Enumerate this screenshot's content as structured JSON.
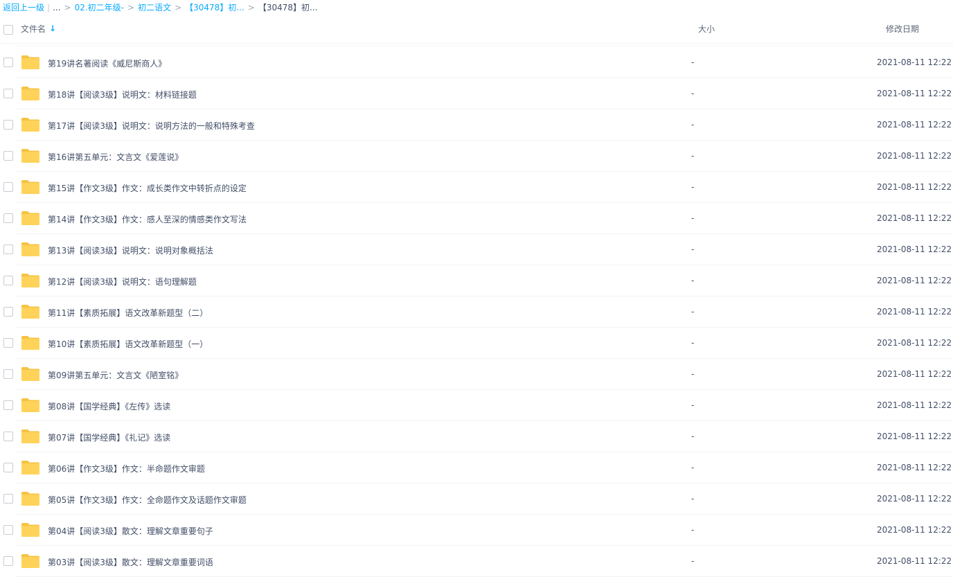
{
  "breadcrumb": {
    "back_label": "返回上一级",
    "separator": "|",
    "ellipsis": "...",
    "crumbs": [
      "02.初二年级-",
      "初二语文",
      "【30478】初..."
    ],
    "current": "【30478】初...",
    "arrow": ">"
  },
  "header": {
    "name_label": "文件名",
    "sort_arrow": "↓",
    "size_label": "大小",
    "date_label": "修改日期"
  },
  "colors": {
    "link": "#09aaff",
    "folder": "#ffd25a",
    "folder_tab": "#f5c342",
    "text": "#424e67"
  },
  "files": [
    {
      "name": "第19讲名著阅读《威尼斯商人》",
      "size": "-",
      "date": "2021-08-11 12:22",
      "icon": "folder-icon"
    },
    {
      "name": "第18讲【阅读3级】说明文：材料链接题",
      "size": "-",
      "date": "2021-08-11 12:22",
      "icon": "folder-icon"
    },
    {
      "name": "第17讲【阅读3级】说明文：说明方法的一般和特殊考查",
      "size": "-",
      "date": "2021-08-11 12:22",
      "icon": "folder-icon"
    },
    {
      "name": "第16讲第五单元：文言文《爱莲说》",
      "size": "-",
      "date": "2021-08-11 12:22",
      "icon": "folder-icon"
    },
    {
      "name": "第15讲【作文3级】作文：成长类作文中转折点的设定",
      "size": "-",
      "date": "2021-08-11 12:22",
      "icon": "folder-icon"
    },
    {
      "name": "第14讲【作文3级】作文：感人至深的情感类作文写法",
      "size": "-",
      "date": "2021-08-11 12:22",
      "icon": "folder-icon"
    },
    {
      "name": "第13讲【阅读3级】说明文：说明对象概括法",
      "size": "-",
      "date": "2021-08-11 12:22",
      "icon": "folder-icon"
    },
    {
      "name": "第12讲【阅读3级】说明文：语句理解题",
      "size": "-",
      "date": "2021-08-11 12:22",
      "icon": "folder-icon"
    },
    {
      "name": "第11讲【素质拓展】语文改革新题型（二）",
      "size": "-",
      "date": "2021-08-11 12:22",
      "icon": "folder-icon"
    },
    {
      "name": "第10讲【素质拓展】语文改革新题型（一）",
      "size": "-",
      "date": "2021-08-11 12:22",
      "icon": "folder-icon"
    },
    {
      "name": "第09讲第五单元：文言文《陋室铭》",
      "size": "-",
      "date": "2021-08-11 12:22",
      "icon": "folder-icon"
    },
    {
      "name": "第08讲【国学经典】《左传》选读",
      "size": "-",
      "date": "2021-08-11 12:22",
      "icon": "folder-icon"
    },
    {
      "name": "第07讲【国学经典】《礼记》选读",
      "size": "-",
      "date": "2021-08-11 12:22",
      "icon": "folder-icon"
    },
    {
      "name": "第06讲【作文3级】作文：半命题作文审题",
      "size": "-",
      "date": "2021-08-11 12:22",
      "icon": "folder-icon"
    },
    {
      "name": "第05讲【作文3级】作文：全命题作文及话题作文审题",
      "size": "-",
      "date": "2021-08-11 12:22",
      "icon": "folder-icon"
    },
    {
      "name": "第04讲【阅读3级】散文：理解文章重要句子",
      "size": "-",
      "date": "2021-08-11 12:22",
      "icon": "folder-icon"
    },
    {
      "name": "第03讲【阅读3级】散文：理解文章重要词语",
      "size": "-",
      "date": "2021-08-11 12:22",
      "icon": "folder-icon"
    }
  ]
}
